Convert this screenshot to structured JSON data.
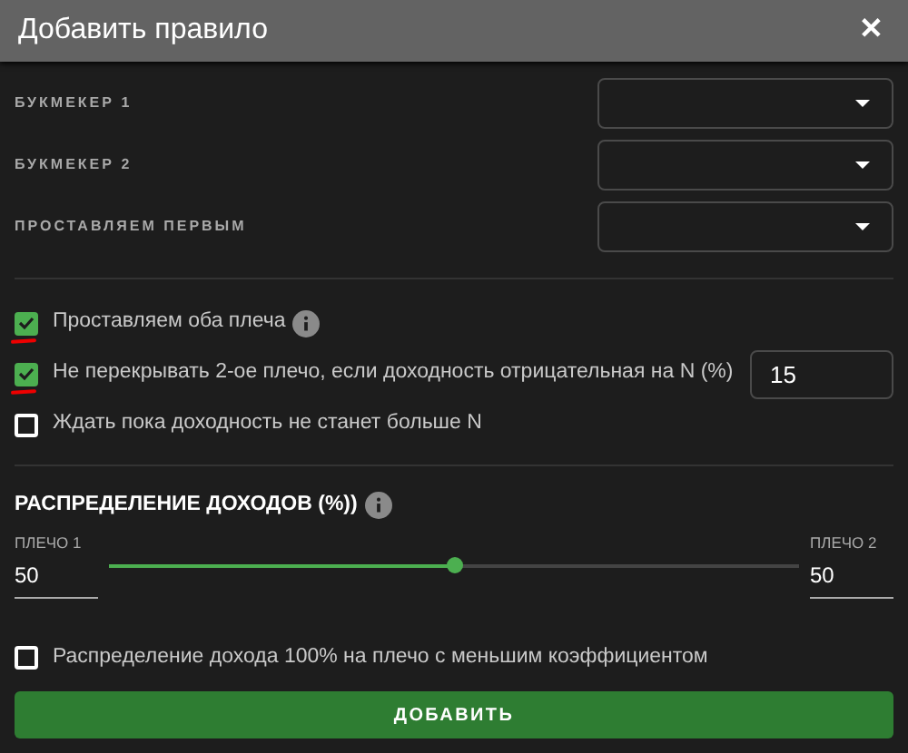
{
  "dialog": {
    "title": "Добавить правило",
    "close": "✕"
  },
  "selects": [
    {
      "label": "БУКМЕКЕР 1"
    },
    {
      "label": "БУКМЕКЕР 2"
    },
    {
      "label": "ПРОСТАВЛЯЕМ ПЕРВЫМ"
    }
  ],
  "options": [
    {
      "label": "Проставляем оба плеча",
      "checked": true,
      "info": true,
      "marked": true
    },
    {
      "label": "Не перекрывать 2-ое плечо, если доходность отрицательная на N (%)",
      "checked": true,
      "marked": true,
      "value": "15"
    },
    {
      "label": "Ждать пока доходность не станет больше N",
      "checked": false,
      "marked": false
    }
  ],
  "distribution": {
    "title": "РАСПРЕДЕЛЕНИЕ ДОХОДОВ (%))",
    "info": true,
    "left": {
      "label": "ПЛЕЧО 1",
      "value": "50"
    },
    "right": {
      "label": "ПЛЕЧО 2",
      "value": "50"
    },
    "level": 0.5
  },
  "extra": {
    "label": "Распределение дохода 100% на плечо с меньшим коэффициентом",
    "checked": false
  },
  "submit": "ДОБАВИТЬ"
}
